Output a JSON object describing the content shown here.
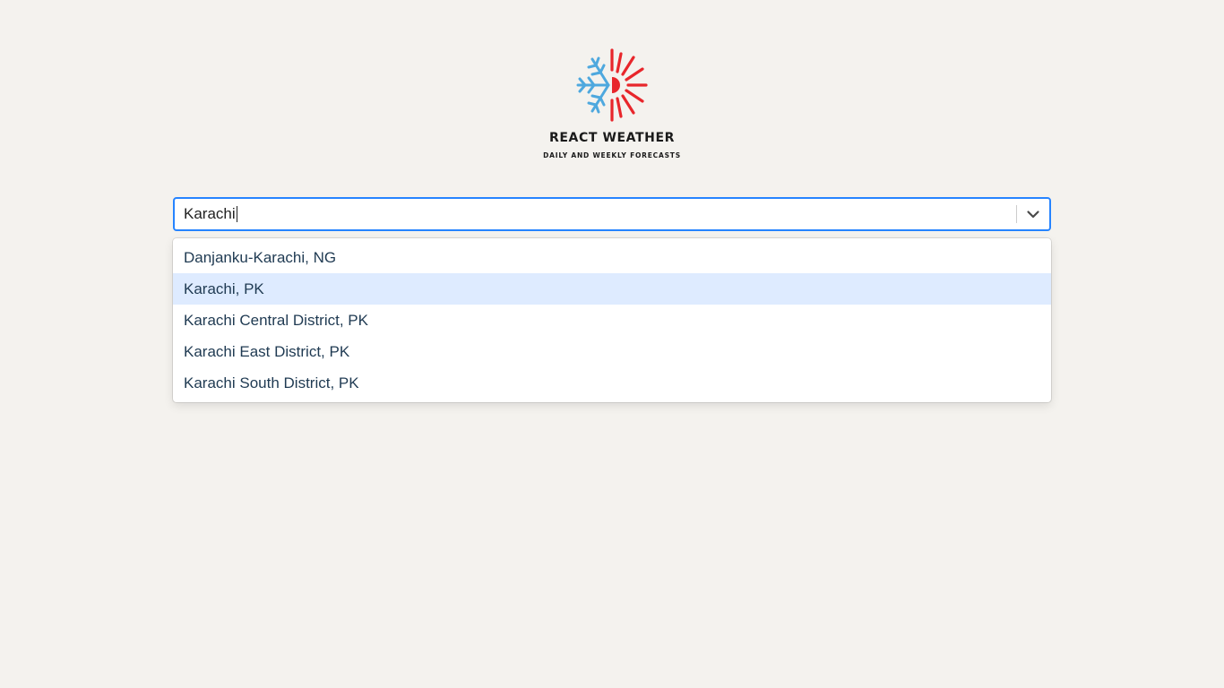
{
  "brand": {
    "title": "REACT WEATHER",
    "subtitle": "DAILY AND WEEKLY FORECASTS",
    "logo_icon": "snowflake-sun-icon",
    "logo_colors": {
      "snowflake": "#4ea8de",
      "sun": "#e8262b"
    }
  },
  "search": {
    "value": "Karachi",
    "dropdown_icon": "chevron-down-icon",
    "focus_color": "#2684ff"
  },
  "menu": {
    "options": [
      {
        "label": "Danjanku-Karachi, NG"
      },
      {
        "label": "Karachi, PK"
      },
      {
        "label": "Karachi Central District, PK"
      },
      {
        "label": "Karachi East District, PK"
      },
      {
        "label": "Karachi South District, PK"
      }
    ],
    "focused_index": 1,
    "focus_bg": "#deebff"
  }
}
